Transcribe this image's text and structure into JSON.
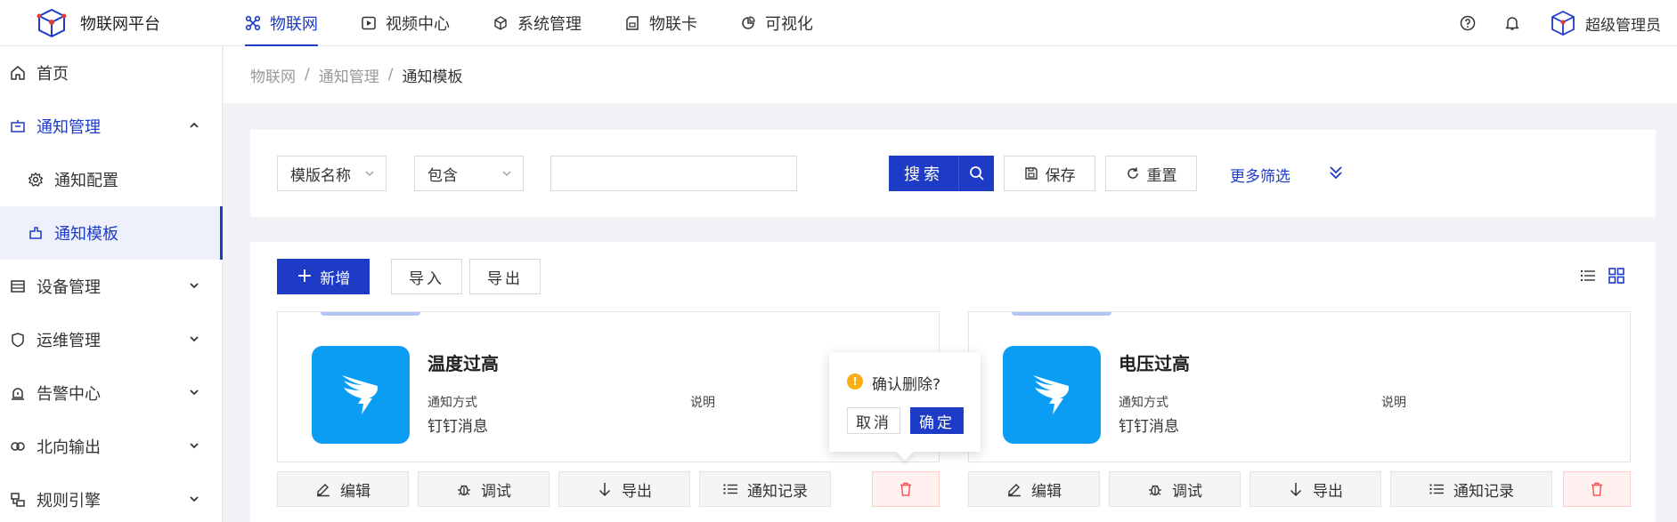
{
  "app": {
    "title": "物联网平台"
  },
  "topnav": [
    {
      "label": "物联网",
      "icon": "iot-icon",
      "active": true
    },
    {
      "label": "视频中心",
      "icon": "play-icon"
    },
    {
      "label": "系统管理",
      "icon": "cube-icon"
    },
    {
      "label": "物联卡",
      "icon": "sim-card-icon"
    },
    {
      "label": "可视化",
      "icon": "pie-chart-icon"
    }
  ],
  "user": {
    "name": "超级管理员"
  },
  "sidebar": {
    "items": [
      {
        "label": "首页",
        "icon": "home-icon"
      },
      {
        "label": "通知管理",
        "icon": "notification-icon",
        "expanded": true
      },
      {
        "label": "通知配置",
        "icon": "gear-icon",
        "sub": true
      },
      {
        "label": "通知模板",
        "icon": "template-icon",
        "sub": true,
        "selected": true
      },
      {
        "label": "设备管理",
        "icon": "device-icon"
      },
      {
        "label": "运维管理",
        "icon": "ops-icon"
      },
      {
        "label": "告警中心",
        "icon": "alarm-icon"
      },
      {
        "label": "北向输出",
        "icon": "output-icon"
      },
      {
        "label": "规则引擎",
        "icon": "rule-icon"
      }
    ]
  },
  "breadcrumb": {
    "items": [
      "物联网",
      "通知管理"
    ],
    "current": "通知模板",
    "separator": "/"
  },
  "filter": {
    "field": "模版名称",
    "operator": "包含",
    "value": "",
    "search_label": "搜索",
    "save_label": "保存",
    "reset_label": "重置",
    "more_label": "更多筛选"
  },
  "toolbar": {
    "add_label": "新增",
    "import_label": "导入",
    "export_label": "导出"
  },
  "templates": [
    {
      "name": "温度过高",
      "method_key": "通知方式",
      "method": "钉钉消息",
      "desc_key": "说明",
      "icon": "dingtalk-icon"
    },
    {
      "name": "电压过高",
      "method_key": "通知方式",
      "method": "钉钉消息",
      "desc_key": "说明",
      "icon": "dingtalk-icon"
    }
  ],
  "card_actions": {
    "edit": "编辑",
    "debug": "调试",
    "export": "导出",
    "records": "通知记录"
  },
  "popconfirm": {
    "message": "确认删除?",
    "cancel": "取消",
    "ok": "确定"
  },
  "colors": {
    "primary": "#1d3bc4",
    "dingtalk": "#0a9df3",
    "danger": "#ff4d4f",
    "warning": "#faad14"
  }
}
